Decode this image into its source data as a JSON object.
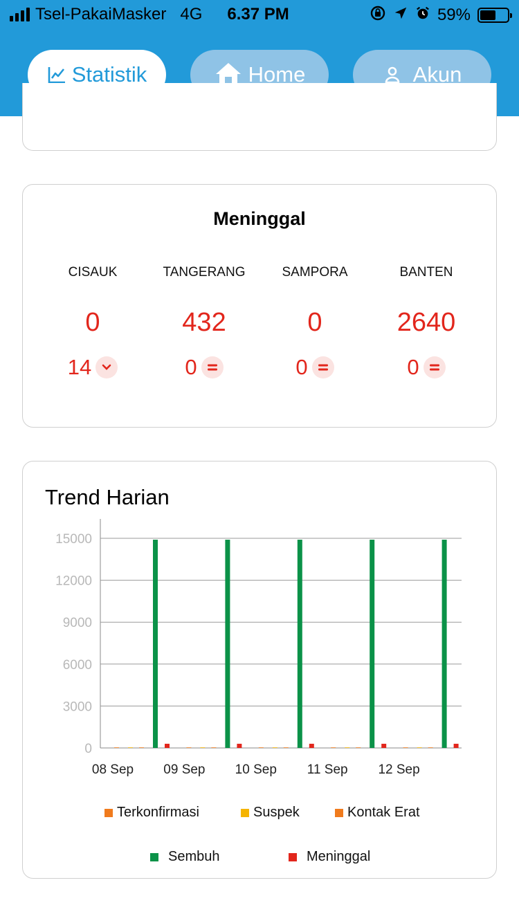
{
  "status_bar": {
    "carrier": "Tsel-PakaiMasker",
    "network": "4G",
    "time": "6.37 PM",
    "battery": "59%",
    "battery_level": 0.59
  },
  "nav": {
    "items": [
      {
        "label": "Statistik",
        "icon": "chart-line-icon",
        "active": true
      },
      {
        "label": "Home",
        "icon": "home-icon",
        "active": false
      },
      {
        "label": "Akun",
        "icon": "user-icon",
        "active": false
      }
    ]
  },
  "meninggal": {
    "title": "Meninggal",
    "columns": [
      {
        "name": "CISAUK",
        "value": "0",
        "change": "14",
        "change_icon": "chevron-down-icon"
      },
      {
        "name": "TANGERANG",
        "value": "432",
        "change": "0",
        "change_icon": "equals-icon"
      },
      {
        "name": "SAMPORA",
        "value": "0",
        "change": "0",
        "change_icon": "equals-icon"
      },
      {
        "name": "BANTEN",
        "value": "2640",
        "change": "0",
        "change_icon": "equals-icon"
      }
    ]
  },
  "trend": {
    "title": "Trend Harian"
  },
  "colors": {
    "header": "#229ad9",
    "terkonfirmasi": "#f07b1d",
    "suspek": "#f5b400",
    "kontak_erat": "#f07b1d",
    "sembuh": "#0b9248",
    "meninggal": "#e2261c",
    "danger_text": "#e2261c"
  },
  "chart_data": {
    "type": "bar",
    "title": "Trend Harian",
    "categories": [
      "08 Sep",
      "09 Sep",
      "10 Sep",
      "11 Sep",
      "12 Sep"
    ],
    "series": [
      {
        "name": "Terkonfirmasi",
        "values": [
          0,
          0,
          0,
          0,
          0
        ]
      },
      {
        "name": "Suspek",
        "values": [
          0,
          0,
          0,
          0,
          0
        ]
      },
      {
        "name": "Kontak Erat",
        "values": [
          0,
          0,
          0,
          0,
          0
        ]
      },
      {
        "name": "Sembuh",
        "values": [
          14900,
          14900,
          14900,
          14900,
          14900
        ]
      },
      {
        "name": "Meninggal",
        "values": [
          300,
          300,
          300,
          300,
          300
        ]
      }
    ],
    "yticks": [
      0,
      3000,
      6000,
      9000,
      12000,
      15000
    ],
    "ylim": [
      0,
      15000
    ],
    "grid": true,
    "legend_position": "bottom"
  }
}
